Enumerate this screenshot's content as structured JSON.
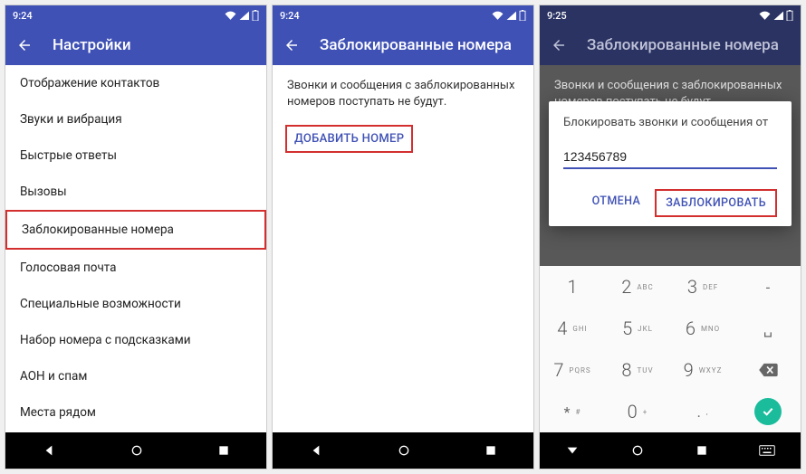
{
  "screen1": {
    "time": "9:24",
    "title": "Настройки",
    "items": [
      "Отображение контактов",
      "Звуки и вибрация",
      "Быстрые ответы",
      "Вызовы",
      "Заблокированные номера",
      "Голосовая почта",
      "Специальные возможности",
      "Набор номера с подсказками",
      "АОН и спам",
      "Места рядом"
    ]
  },
  "screen2": {
    "time": "9:24",
    "title": "Заблокированные номера",
    "description": "Звонки и сообщения с заблокированных номеров поступать не будут.",
    "addLabel": "ДОБАВИТЬ НОМЕР"
  },
  "screen3": {
    "time": "9:25",
    "title": "Заблокированные номера",
    "description": "Звонки и сообщения с заблокированных номеров поступать не будут.",
    "dialog": {
      "title": "Блокировать звонки и сообщения от",
      "value": "123456789",
      "cancel": "ОТМЕНА",
      "confirm": "ЗАБЛОКИРОВАТЬ"
    },
    "keypad": [
      [
        {
          "n": "1",
          "l": ""
        },
        {
          "n": "2",
          "l": "ABC"
        },
        {
          "n": "3",
          "l": "DEF"
        },
        {
          "n": "-",
          "l": ""
        }
      ],
      [
        {
          "n": "4",
          "l": "GHI"
        },
        {
          "n": "5",
          "l": "JKL"
        },
        {
          "n": "6",
          "l": "MNO"
        },
        {
          "n": "␣",
          "l": ""
        }
      ],
      [
        {
          "n": "7",
          "l": "PQRS"
        },
        {
          "n": "8",
          "l": "TUV"
        },
        {
          "n": "9",
          "l": "WXYZ"
        },
        {
          "n": "⌫",
          "l": ""
        }
      ],
      [
        {
          "n": "*",
          "l": "#"
        },
        {
          "n": "0",
          "l": "+"
        },
        {
          "n": ".",
          "l": ","
        },
        {
          "n": "✓",
          "l": ""
        }
      ]
    ]
  }
}
